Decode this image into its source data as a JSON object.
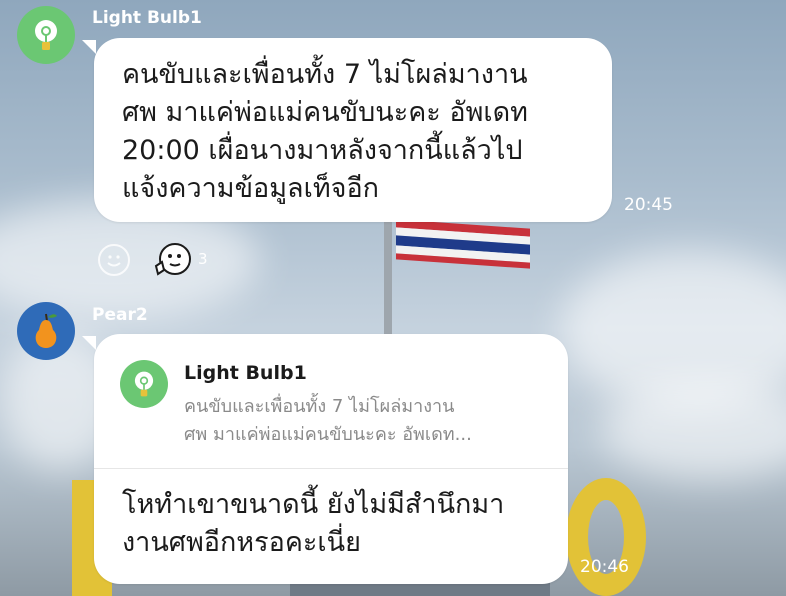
{
  "messages": [
    {
      "sender": "Light Bulb1",
      "avatar_icon": "light-bulb-icon",
      "lines": [
        "คนขับและเพื่อนทั้ง 7 ไม่โผล่มางาน",
        "ศพ มาแค่พ่อแม่คนขับนะคะ อัพเดท",
        "20:00 เผื่อนางมาหลังจากนี้แล้วไป",
        "แจ้งความข้อมูลเท็จอีก"
      ],
      "time": "20:45",
      "reaction_count": "3"
    },
    {
      "sender": "Pear2",
      "avatar_icon": "pear-icon",
      "quote": {
        "sender": "Light Bulb1",
        "lines": [
          "คนขับและเพื่อนทั้ง 7 ไม่โผล่มางาน",
          "ศพ มาแค่พ่อแม่คนขับนะคะ อัพเดท..."
        ]
      },
      "lines": [
        "โหทำเขาขนาดนี้ ยังไม่มีสำนึกมา",
        "งานศพอีกหรอคะเนี่ย"
      ],
      "time": "20:46"
    }
  ]
}
